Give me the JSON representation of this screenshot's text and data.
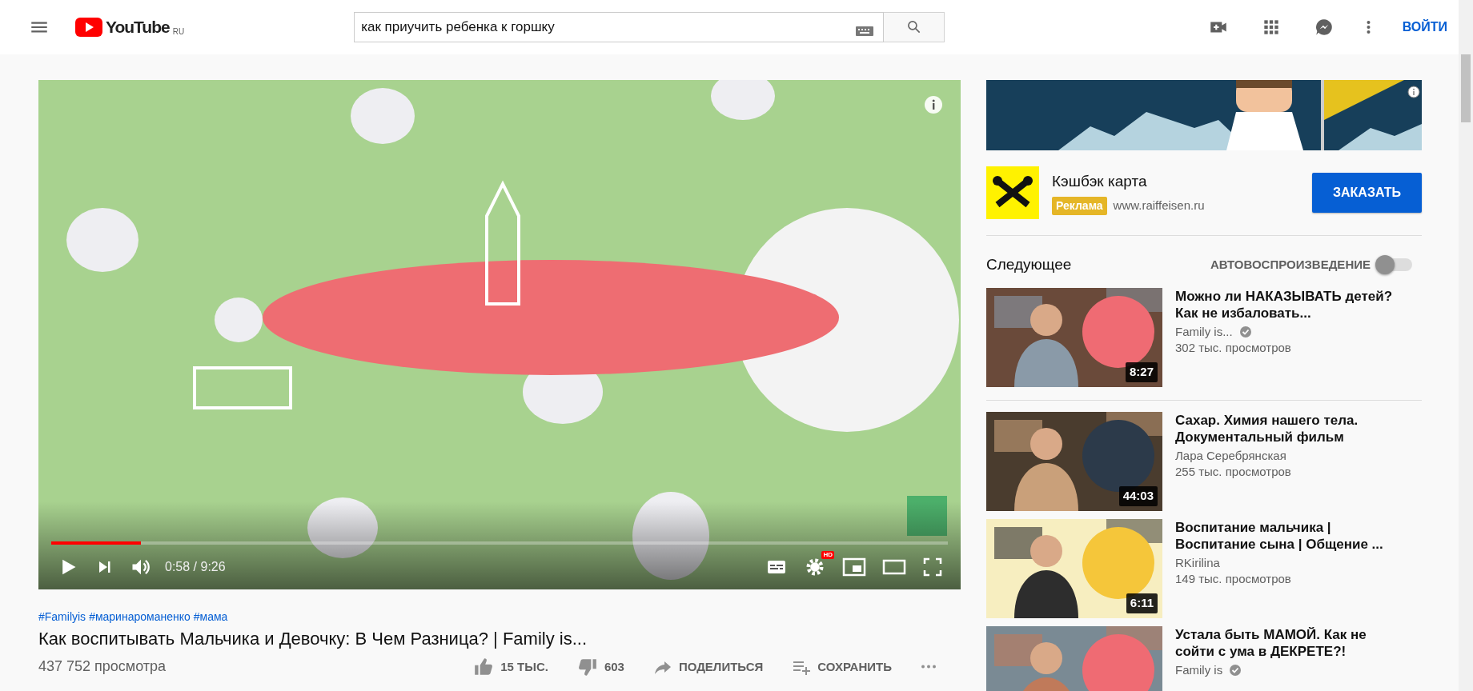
{
  "header": {
    "logo_text": "YouTube",
    "logo_region": "RU",
    "search": {
      "value": "как приучить ребенка к горшку"
    },
    "signin": "ВОЙТИ"
  },
  "player": {
    "progress": {
      "level": 0.1
    },
    "time": "0:58 / 9:26",
    "hd_badge": "HD"
  },
  "video": {
    "hashtags": [
      "#Familyis",
      "#маринароманенко",
      "#мама"
    ],
    "title": "Как воспитывать Мальчика и Девочку: В Чем Разница? | Family is...",
    "views": "437 752 просмотра",
    "likes": "15 ТЫС.",
    "dislikes": "603",
    "share": "ПОДЕЛИТЬСЯ",
    "save": "СОХРАНИТЬ"
  },
  "ad": {
    "title": "Кэшбэк карта",
    "badge": "Реклама",
    "url": "www.raiffeisen.ru",
    "button": "ЗАКАЗАТЬ"
  },
  "up_next": {
    "heading": "Следующее",
    "autoplay_label": "АВТОВОСПРОИЗВЕДЕНИЕ",
    "autoplay_on": false
  },
  "videos": [
    {
      "title": "Можно ли НАКАЗЫВАТЬ детей? Как не избаловать...",
      "channel": "Family is...",
      "verified": true,
      "views": "302 тыс. просмотров",
      "duration": "8:27"
    },
    {
      "title": "Сахар. Химия нашего тела. Документальный фильм",
      "channel": "Лара Серебрянская",
      "verified": false,
      "views": "255 тыс. просмотров",
      "duration": "44:03"
    },
    {
      "title": "Воспитание мальчика | Воспитание сына | Общение ...",
      "channel": "RKirilina",
      "verified": false,
      "views": "149 тыс. просмотров",
      "duration": "6:11"
    },
    {
      "title": "Устала быть МАМОЙ. Как не сойти с ума в ДЕКРЕТЕ?!",
      "channel": "Family is",
      "verified": true
    }
  ]
}
